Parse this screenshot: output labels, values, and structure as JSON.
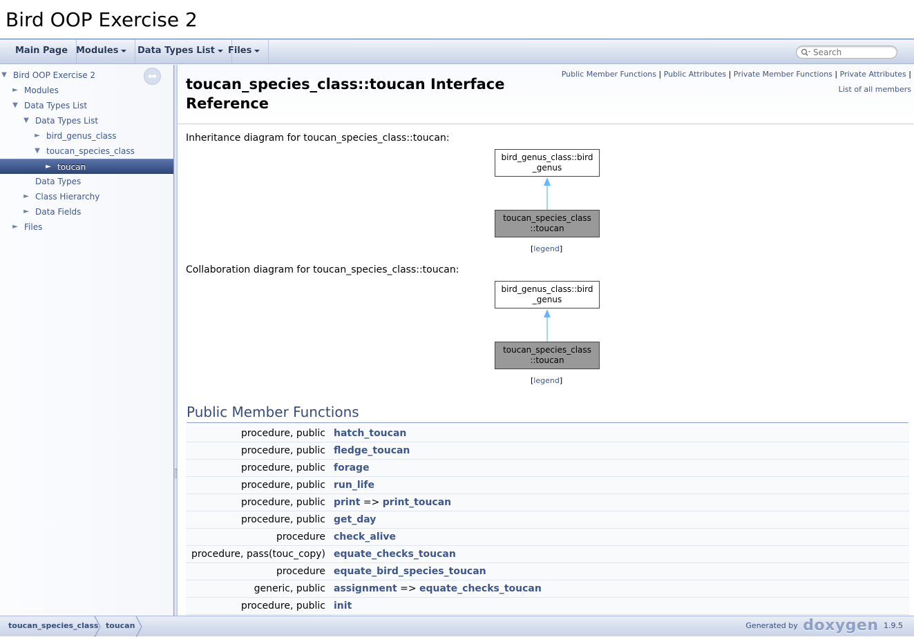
{
  "project": {
    "name": "Bird OOP Exercise 2"
  },
  "menu": {
    "items": [
      {
        "label": "Main Page",
        "has_caret": false
      },
      {
        "label": "Modules",
        "has_caret": true
      },
      {
        "label": "Data Types List",
        "has_caret": true
      },
      {
        "label": "Files",
        "has_caret": true
      }
    ],
    "search_placeholder": "Search"
  },
  "sidebar": {
    "items": [
      {
        "label": "Bird OOP Exercise 2",
        "arrow": "▼",
        "selected": false
      },
      {
        "label": "Modules",
        "arrow": "►",
        "selected": false
      },
      {
        "label": "Data Types List",
        "arrow": "▼",
        "selected": false
      },
      {
        "label": "Data Types List",
        "arrow": "▼",
        "selected": false
      },
      {
        "label": "bird_genus_class",
        "arrow": "►",
        "selected": false
      },
      {
        "label": "toucan_species_class",
        "arrow": "▼",
        "selected": false
      },
      {
        "label": "toucan",
        "arrow": "►",
        "selected": true
      },
      {
        "label": "Data Types",
        "arrow": "",
        "selected": false
      },
      {
        "label": "Class Hierarchy",
        "arrow": "►",
        "selected": false
      },
      {
        "label": "Data Fields",
        "arrow": "►",
        "selected": false
      },
      {
        "label": "Files",
        "arrow": "►",
        "selected": false
      }
    ]
  },
  "summary": {
    "links": [
      "Public Member Functions",
      "Public Attributes",
      "Private Member Functions",
      "Private Attributes"
    ],
    "separator": "|",
    "all_members": "List of all members"
  },
  "page_title": "toucan_species_class::toucan Interface Reference",
  "inheritance": {
    "caption": "Inheritance diagram for toucan_species_class::toucan:",
    "base_line1": "bird_genus_class::bird",
    "base_line2": "_genus",
    "self_line1": "toucan_species_class",
    "self_line2": "::toucan",
    "legend": "legend"
  },
  "collaboration": {
    "caption": "Collaboration diagram for toucan_species_class::toucan:",
    "base_line1": "bird_genus_class::bird",
    "base_line2": "_genus",
    "self_line1": "toucan_species_class",
    "self_line2": "::toucan",
    "legend": "legend"
  },
  "public_member_functions": {
    "heading": "Public Member Functions",
    "rows": [
      {
        "qualifiers": "procedure, public",
        "name": "hatch_toucan",
        "arrow": "",
        "target": ""
      },
      {
        "qualifiers": "procedure, public",
        "name": "fledge_toucan",
        "arrow": "",
        "target": ""
      },
      {
        "qualifiers": "procedure, public",
        "name": "forage",
        "arrow": "",
        "target": ""
      },
      {
        "qualifiers": "procedure, public",
        "name": "run_life",
        "arrow": "",
        "target": ""
      },
      {
        "qualifiers": "procedure, public",
        "name": "print",
        "arrow": "=>",
        "target": "print_toucan"
      },
      {
        "qualifiers": "procedure, public",
        "name": "get_day",
        "arrow": "",
        "target": ""
      },
      {
        "qualifiers": "procedure",
        "name": "check_alive",
        "arrow": "",
        "target": ""
      },
      {
        "qualifiers": "procedure, pass(touc_copy)",
        "name": "equate_checks_toucan",
        "arrow": "",
        "target": ""
      },
      {
        "qualifiers": "procedure",
        "name": "equate_bird_species_toucan",
        "arrow": "",
        "target": ""
      },
      {
        "qualifiers": "generic, public",
        "name": "assignment",
        "arrow": "=>",
        "target": "equate_checks_toucan"
      },
      {
        "qualifiers": "procedure, public",
        "name": "init",
        "arrow": "",
        "target": ""
      }
    ]
  },
  "footer": {
    "breadcrumbs": [
      "toucan_species_class",
      "toucan"
    ],
    "generated_by": "Generated by",
    "logo_text": "doxygen",
    "version": "1.9.5"
  },
  "colors": {
    "link": "#3d578c",
    "heading": "#354c7b",
    "selected_nav": "#2d4573",
    "derived_box": "#999999",
    "diagram_arrow": "#63b8ff"
  }
}
